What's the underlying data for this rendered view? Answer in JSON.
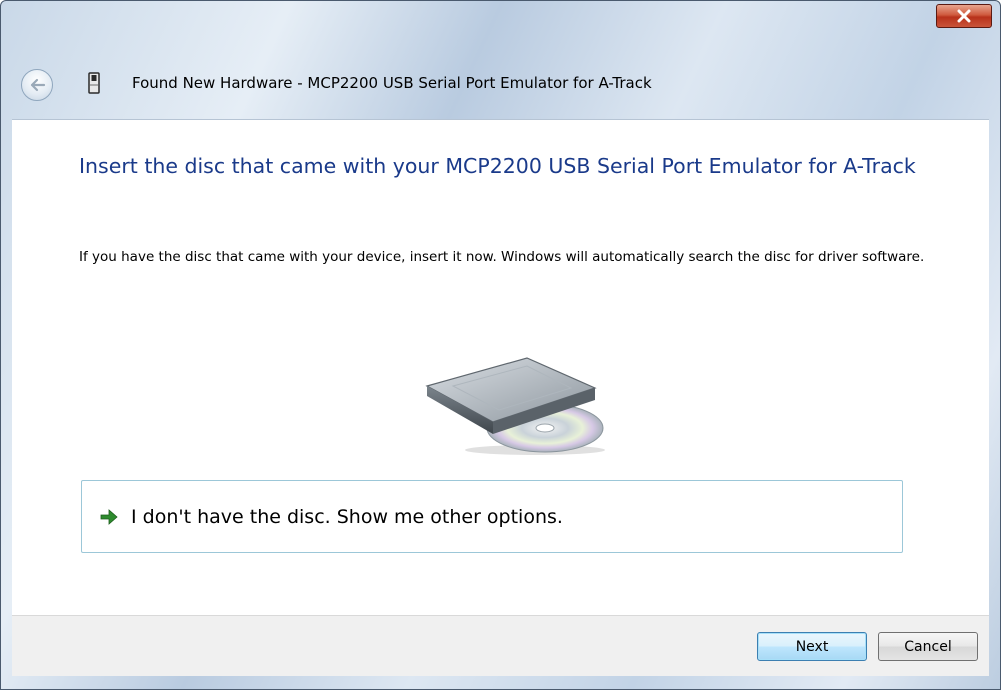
{
  "window": {
    "title": "Found New Hardware - MCP2200 USB Serial Port Emulator for A-Track"
  },
  "titlebar": {
    "close_icon": "close-x-icon",
    "back_icon": "back-arrow-icon",
    "hardware_icon": "usb-device-icon"
  },
  "main": {
    "heading": "Insert the disc that came with your MCP2200 USB Serial Port Emulator for A-Track",
    "description": "If you have the disc that came with your device, insert it now.  Windows will automatically search the disc for driver software.",
    "image": "disc-drive-icon",
    "option": {
      "icon": "green-arrow-icon",
      "label": "I don't have the disc.  Show me other options."
    }
  },
  "footer": {
    "next_label": "Next",
    "cancel_label": "Cancel"
  },
  "colors": {
    "heading": "#1a3a8a",
    "option_border": "#9cc7d8",
    "close_button": "#c9543a",
    "arrow": "#2e8b2e"
  }
}
